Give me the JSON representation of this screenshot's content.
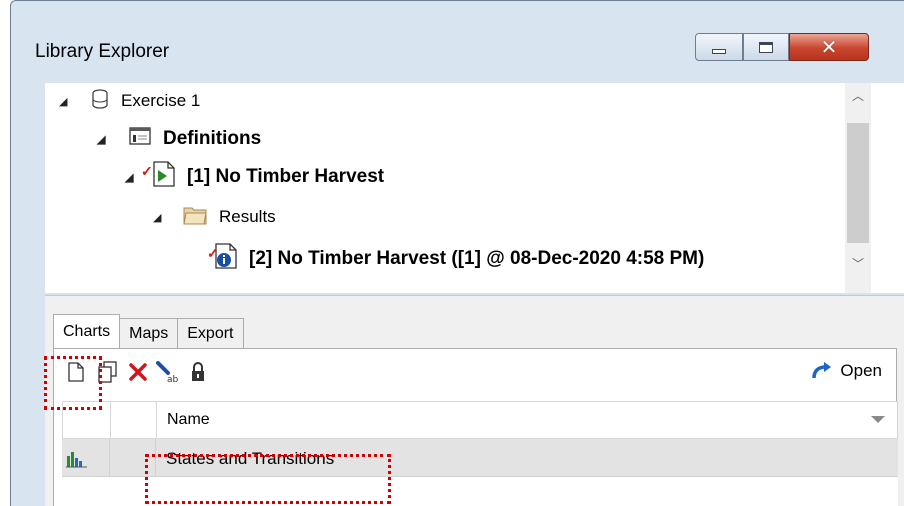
{
  "window": {
    "title": "Library Explorer",
    "buttons": {
      "minimize_icon": "minimize-icon",
      "maximize_icon": "maximize-icon",
      "close_glyph": "✕"
    }
  },
  "tree": {
    "library": {
      "label": "Exercise 1",
      "icon": "database-icon"
    },
    "definitions": {
      "label": "Definitions",
      "icon": "definitions-icon"
    },
    "scenario": {
      "label": "[1] No Timber Harvest",
      "icon": "scenario-icon",
      "checked": true
    },
    "results_folder": {
      "label": "Results",
      "icon": "folder-icon"
    },
    "result": {
      "label": "[2] No Timber Harvest ([1] @ 08-Dec-2020 4:58 PM)",
      "icon": "result-info-icon",
      "checked": true
    }
  },
  "tabs": [
    {
      "label": "Charts",
      "active": true
    },
    {
      "label": "Maps",
      "active": false
    },
    {
      "label": "Export",
      "active": false
    }
  ],
  "toolbar": {
    "items": [
      "new-icon",
      "copy-icon",
      "delete-icon",
      "rename-icon",
      "lock-icon"
    ],
    "open_label": "Open"
  },
  "grid": {
    "columns": [
      "",
      "",
      "Name"
    ],
    "rows": [
      {
        "icon": "bar-chart-icon",
        "name": "States and Transitions"
      }
    ]
  },
  "colors": {
    "highlight": "#d00000",
    "delete_red": "#d3141c",
    "open_arrow": "#1c64c8"
  }
}
